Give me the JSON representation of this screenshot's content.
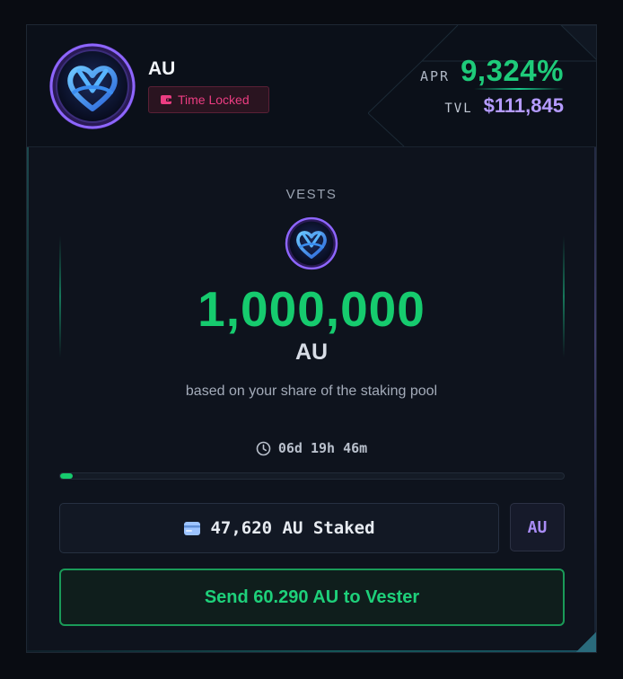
{
  "token": {
    "name": "AU",
    "badge": "Time Locked"
  },
  "stats": {
    "apr_label": "APR",
    "apr_value": "9,324%",
    "tvl_label": "TVL",
    "tvl_value": "$111,845"
  },
  "vests": {
    "label": "VESTS",
    "amount": "1,000,000",
    "unit": "AU",
    "subtitle": "based on your share of the staking pool"
  },
  "timer": {
    "remaining": "06d 19h 46m"
  },
  "progress": {
    "fraction": 0.025
  },
  "staked": {
    "label": "47,620 AU Staked"
  },
  "token_button": {
    "label": "AU"
  },
  "send_button": {
    "label": "Send 60.290 AU to Vester"
  },
  "colors": {
    "accent_green": "#16cb6e",
    "accent_purple": "#b59bff",
    "badge_pink": "#ec3d82",
    "background": "#0e131d"
  },
  "icons": {
    "avatar": "heart-knot-token-logo",
    "badge": "wallet-icon",
    "timer": "clock-icon",
    "staked": "wallet-icon"
  }
}
